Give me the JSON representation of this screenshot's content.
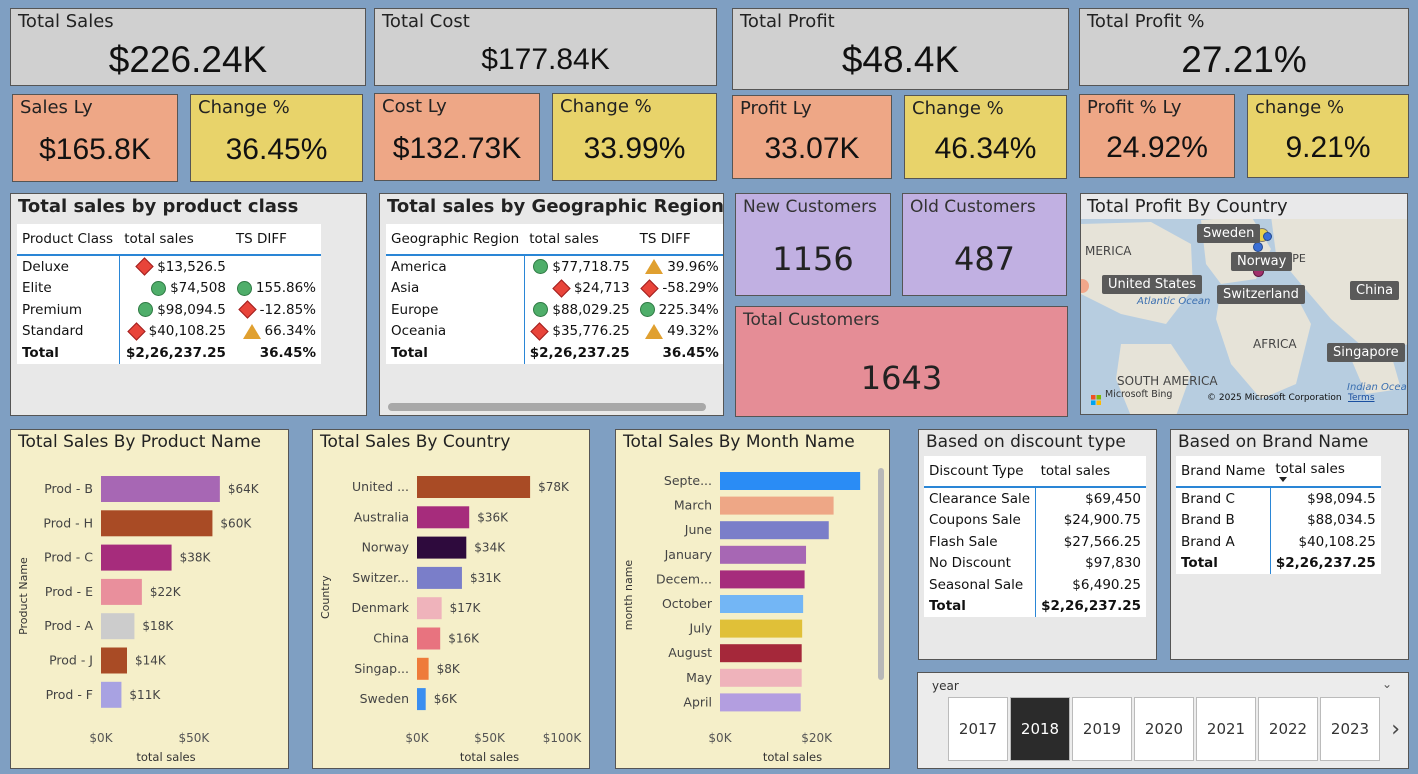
{
  "kpis": {
    "total_sales": {
      "title": "Total Sales",
      "value": "$226.24K"
    },
    "total_cost": {
      "title": "Total Cost",
      "value": "$177.84K"
    },
    "total_profit": {
      "title": "Total Profit",
      "value": "$48.4K"
    },
    "total_profit_pct": {
      "title": "Total Profit %",
      "value": "27.21%"
    },
    "sales_ly": {
      "title": "Sales Ly",
      "value": "$165.8K"
    },
    "sales_change": {
      "title": "Change %",
      "value": "36.45%"
    },
    "cost_ly": {
      "title": "Cost Ly",
      "value": "$132.73K"
    },
    "cost_change": {
      "title": "Change %",
      "value": "33.99%"
    },
    "profit_ly": {
      "title": "Profit Ly",
      "value": "33.07K"
    },
    "profit_change": {
      "title": "Change %",
      "value": "46.34%"
    },
    "profit_pct_ly": {
      "title": "Profit % Ly",
      "value": "24.92%"
    },
    "profit_pct_change": {
      "title": "change %",
      "value": "9.21%"
    }
  },
  "customers": {
    "new": {
      "title": "New Customers",
      "value": "1156"
    },
    "old": {
      "title": "Old Customers",
      "value": "487"
    },
    "total": {
      "title": "Total Customers",
      "value": "1643"
    }
  },
  "product_class_table": {
    "title": "Total sales by product class",
    "headers": [
      "Product Class",
      "total sales",
      "TS DIFF"
    ],
    "rows": [
      {
        "name": "Deluxe",
        "sales": "$13,526.5",
        "sales_icon": "diamond",
        "diff": "",
        "diff_icon": ""
      },
      {
        "name": "Elite",
        "sales": "$74,508",
        "sales_icon": "circle",
        "diff": "155.86%",
        "diff_icon": "circle"
      },
      {
        "name": "Premium",
        "sales": "$98,094.5",
        "sales_icon": "circle",
        "diff": "-12.85%",
        "diff_icon": "diamond"
      },
      {
        "name": "Standard",
        "sales": "$40,108.25",
        "sales_icon": "diamond",
        "diff": "66.34%",
        "diff_icon": "triangle"
      }
    ],
    "total": {
      "name": "Total",
      "sales": "$2,26,237.25",
      "diff": "36.45%"
    }
  },
  "region_table": {
    "title": "Total sales by Geographic Region",
    "headers": [
      "Geographic Region",
      "total sales",
      "TS DIFF"
    ],
    "rows": [
      {
        "name": "America",
        "sales": "$77,718.75",
        "sales_icon": "circle",
        "diff": "39.96%",
        "diff_icon": "triangle"
      },
      {
        "name": "Asia",
        "sales": "$24,713",
        "sales_icon": "diamond",
        "diff": "-58.29%",
        "diff_icon": "diamond"
      },
      {
        "name": "Europe",
        "sales": "$88,029.25",
        "sales_icon": "circle",
        "diff": "225.34%",
        "diff_icon": "circle"
      },
      {
        "name": "Oceania",
        "sales": "$35,776.25",
        "sales_icon": "diamond",
        "diff": "49.32%",
        "diff_icon": "triangle"
      }
    ],
    "total": {
      "name": "Total",
      "sales": "$2,26,237.25",
      "diff": "36.45%"
    }
  },
  "map": {
    "title": "Total Profit By Country",
    "labels": [
      "Sweden",
      "Norway",
      "United States",
      "Switzerland",
      "China",
      "Singapore"
    ],
    "region_labels": [
      "MERICA",
      "EUROPE",
      "Atlantic Ocean",
      "AFRICA",
      "SOUTH AMERICA",
      "Indian Ocea"
    ],
    "bing_label": "Microsoft Bing",
    "copyright": "© 2025 Microsoft Corporation",
    "terms": "Terms"
  },
  "discount_table": {
    "title": "Based on discount type",
    "headers": [
      "Discount Type",
      "total sales"
    ],
    "rows": [
      [
        "Clearance Sale",
        "$69,450"
      ],
      [
        "Coupons Sale",
        "$24,900.75"
      ],
      [
        "Flash Sale",
        "$27,566.25"
      ],
      [
        "No Discount",
        "$97,830"
      ],
      [
        "Seasonal Sale",
        "$6,490.25"
      ]
    ],
    "total": [
      "Total",
      "$2,26,237.25"
    ]
  },
  "brand_table": {
    "title": "Based on Brand Name",
    "headers": [
      "Brand Name",
      "total sales"
    ],
    "rows": [
      [
        "Brand C",
        "$98,094.5"
      ],
      [
        "Brand B",
        "$88,034.5"
      ],
      [
        "Brand A",
        "$40,108.25"
      ]
    ],
    "total": [
      "Total",
      "$2,26,237.25"
    ]
  },
  "year_slicer": {
    "label": "year",
    "years": [
      "2017",
      "2018",
      "2019",
      "2020",
      "2021",
      "2022",
      "2023"
    ],
    "selected": "2018"
  },
  "chart_data": [
    {
      "type": "bar",
      "title": "Total Sales By Product Name",
      "xlabel": "total sales",
      "ylabel": "Product Name",
      "xlim": [
        0,
        70000
      ],
      "xticks": [
        "$0K",
        "$50K"
      ],
      "categories": [
        "Prod - B",
        "Prod - H",
        "Prod - C",
        "Prod - E",
        "Prod - A",
        "Prod - J",
        "Prod - F"
      ],
      "values": [
        64000,
        60000,
        38000,
        22000,
        18000,
        14000,
        11000
      ],
      "data_labels": [
        "$64K",
        "$60K",
        "$38K",
        "$22K",
        "$18K",
        "$14K",
        "$11K"
      ],
      "colors": [
        "#a767b4",
        "#a94b25",
        "#a62c7c",
        "#e98f9c",
        "#cccccc",
        "#a94b25",
        "#a8a2e2"
      ]
    },
    {
      "type": "bar",
      "title": "Total Sales By Country",
      "xlabel": "total sales",
      "ylabel": "Country",
      "xlim": [
        0,
        100000
      ],
      "xticks": [
        "$0K",
        "$50K",
        "$100K"
      ],
      "categories": [
        "United ...",
        "Australia",
        "Norway",
        "Switzer...",
        "Denmark",
        "China",
        "Singap...",
        "Sweden"
      ],
      "values": [
        78000,
        36000,
        34000,
        31000,
        17000,
        16000,
        8000,
        6000
      ],
      "data_labels": [
        "$78K",
        "$36K",
        "$34K",
        "$31K",
        "$17K",
        "$16K",
        "$8K",
        "$6K"
      ],
      "colors": [
        "#a94b25",
        "#a62c7c",
        "#2e0a3d",
        "#7a7ec9",
        "#efb3bb",
        "#e8737f",
        "#ee7b3a",
        "#3a8ef0"
      ]
    },
    {
      "type": "bar",
      "title": "Total Sales By Month Name",
      "xlabel": "total sales",
      "ylabel": "month name",
      "xlim": [
        0,
        30000
      ],
      "xticks": [
        "$0K",
        "$20K"
      ],
      "categories": [
        "Septe...",
        "March",
        "June",
        "January",
        "Decem...",
        "October",
        "July",
        "August",
        "May",
        "April"
      ],
      "values": [
        29000,
        23500,
        22500,
        17800,
        17500,
        17200,
        17000,
        16900,
        16900,
        16700
      ],
      "colors": [
        "#2a8cf5",
        "#eea786",
        "#7a7ec9",
        "#a767b4",
        "#a62c7c",
        "#73b6f5",
        "#e0c038",
        "#a5283a",
        "#efb3bb",
        "#b39ee0"
      ]
    }
  ]
}
